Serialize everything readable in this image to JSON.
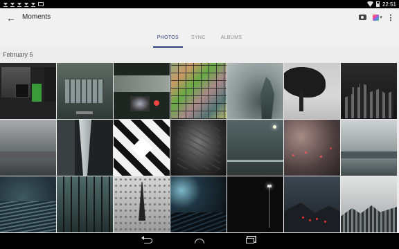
{
  "status_bar": {
    "time": "22:51",
    "notification_icons": [
      "download-icon",
      "download-icon",
      "download-icon",
      "download-icon",
      "download-icon",
      "image-icon"
    ],
    "system_icons": [
      "wifi-icon",
      "battery-icon"
    ]
  },
  "header": {
    "title": "Moments",
    "back_icon": "arrow-left-icon",
    "actions": [
      "camera-icon",
      "color-picker-icon",
      "more-vert-icon"
    ]
  },
  "tabs": [
    {
      "label": "PHOTOS",
      "active": true
    },
    {
      "label": "SYNC",
      "active": false
    },
    {
      "label": "ALBUMS",
      "active": false
    }
  ],
  "gallery": {
    "date_label": "February 5",
    "photos": [
      {
        "id": "p1",
        "desc": "app screenshot dark"
      },
      {
        "id": "p2",
        "desc": "tablet gallery screenshot"
      },
      {
        "id": "p3",
        "desc": "tablet app screenshot"
      },
      {
        "id": "p4",
        "desc": "photo grid collage"
      },
      {
        "id": "p5",
        "desc": "foggy trees"
      },
      {
        "id": "p6",
        "desc": "tree silhouette fog"
      },
      {
        "id": "p7",
        "desc": "city skyline night"
      },
      {
        "id": "p8",
        "desc": "stormy sea"
      },
      {
        "id": "p9",
        "desc": "skyscrapers looking up"
      },
      {
        "id": "p10",
        "desc": "geometric ceiling"
      },
      {
        "id": "p11",
        "desc": "spiral staircase"
      },
      {
        "id": "p12",
        "desc": "foggy road lights"
      },
      {
        "id": "p13",
        "desc": "rainy window bokeh"
      },
      {
        "id": "p14",
        "desc": "foggy bridge river"
      },
      {
        "id": "p15",
        "desc": "ocean waves"
      },
      {
        "id": "p16",
        "desc": "misty forest"
      },
      {
        "id": "p17",
        "desc": "eiffel tower rain"
      },
      {
        "id": "p18",
        "desc": "street lamp night"
      },
      {
        "id": "p19",
        "desc": "dark street light"
      },
      {
        "id": "p20",
        "desc": "bridge with red lights"
      },
      {
        "id": "p21",
        "desc": "misty mountain forest"
      }
    ]
  },
  "nav_bar": {
    "buttons": [
      "back-nav-icon",
      "home-nav-icon",
      "recents-nav-icon"
    ]
  }
}
